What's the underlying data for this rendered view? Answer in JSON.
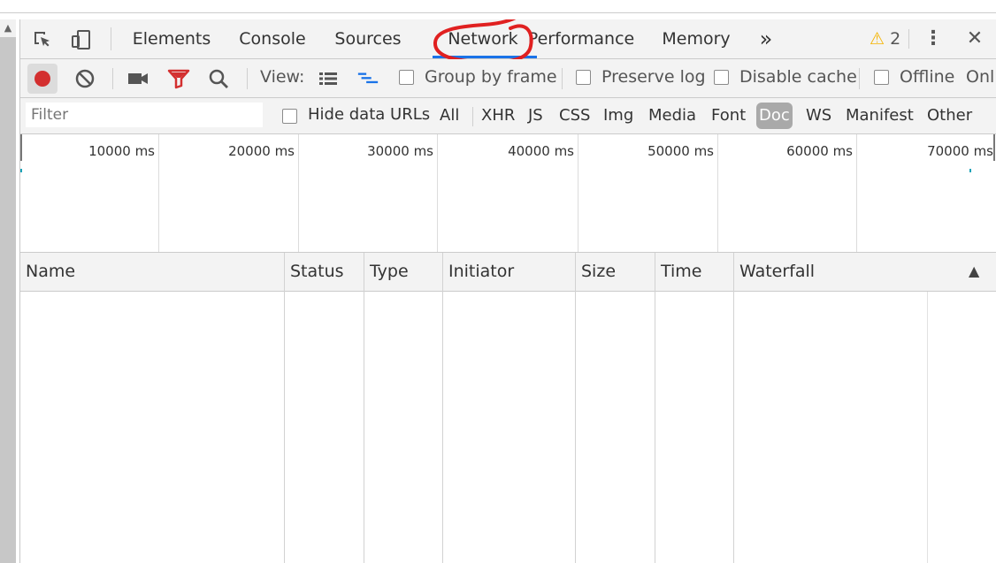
{
  "toolbar": {
    "tabs": [
      "Elements",
      "Console",
      "Sources",
      "Network",
      "Performance",
      "Memory"
    ],
    "more_tabs_glyph": "»",
    "warning_count": "2",
    "warning_glyph": "⚠",
    "menu_glyph": "⋮",
    "close_glyph": "✕"
  },
  "network_toolbar": {
    "view_label": "View:",
    "group_by_frame": "Group by frame",
    "preserve_log": "Preserve log",
    "disable_cache": "Disable cache",
    "offline": "Offline",
    "online_partial": "Onl"
  },
  "filter_bar": {
    "filter_placeholder": "Filter",
    "hide_data_urls": "Hide data URLs",
    "types": [
      "All",
      "XHR",
      "JS",
      "CSS",
      "Img",
      "Media",
      "Font",
      "Doc",
      "WS",
      "Manifest",
      "Other"
    ],
    "selected_type": "Doc"
  },
  "overview": {
    "tick_labels": [
      "10000 ms",
      "20000 ms",
      "30000 ms",
      "40000 ms",
      "50000 ms",
      "60000 ms",
      "70000 ms"
    ]
  },
  "table": {
    "columns": [
      "Name",
      "Status",
      "Type",
      "Initiator",
      "Size",
      "Time",
      "Waterfall"
    ],
    "sort_glyph": "▲"
  },
  "colors": {
    "record": "#d32f2f",
    "filter_active": "#d32f2f",
    "accent": "#1a73e8",
    "annotation": "#e02020",
    "warning": "#f4b400"
  }
}
